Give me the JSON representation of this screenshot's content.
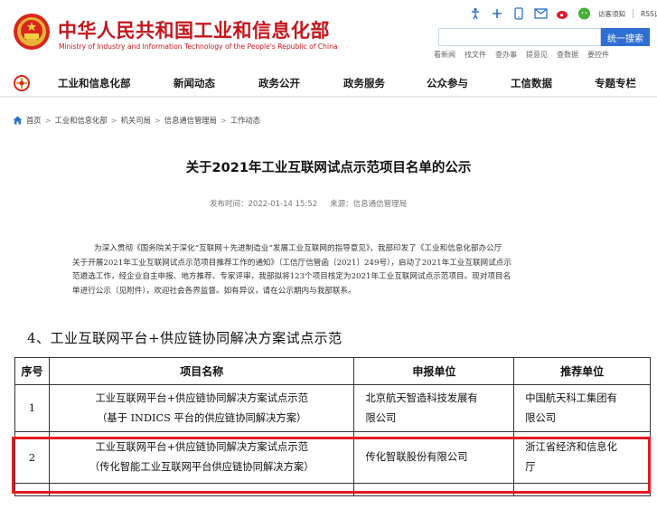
{
  "header": {
    "title_cn": "中华人民共和国工业和信息化部",
    "title_en": "Ministry of Industry and Information Technology of the People's Republic of China",
    "util": {
      "visitor_notice": "访客须知",
      "rss": "RSS订阅"
    },
    "search_button": "统一搜索",
    "tools": [
      "看新闻",
      "找文件",
      "查办事",
      "提意见",
      "查数据",
      "要控件"
    ]
  },
  "nav": {
    "items": [
      "工业和信息化部",
      "新闻动态",
      "政务公开",
      "政务服务",
      "公众参与",
      "工信数据",
      "专题专栏"
    ]
  },
  "breadcrumb": [
    "首页",
    "工业和信息化部",
    "机关司局",
    "信息通信管理局",
    "工作动态"
  ],
  "article": {
    "title": "关于2021年工业互联网试点示范项目名单的公示",
    "published": "发布时间：2022-01-14 15:52",
    "source": "来源：信息通信管理局",
    "paragraph_lines": [
      "为深入贯彻《国务院关于深化“互联网＋先进制造业”发展工业互联网的指导意见》，我部印发了《工业和信息化部办公厅",
      "关于开展2021年工业互联网试点示范项目推荐工作的通知》（工信厅信管函〔2021〕249号），启动了2021年工业互联网试点示",
      "范遴选工作，经企业自主申报、地方推荐、专家评审，我部拟将123个项目核定为2021年工业互联网试点示范项目。现对项目名",
      "单进行公示（见附件），欢迎社会各界监督。如有异议，请在公示期内与我部联系。"
    ],
    "section_heading": "4、工业互联网平台+供应链协同解决方案试点示范",
    "table": {
      "headers": [
        "序号",
        "项目名称",
        "申报单位",
        "推荐单位"
      ],
      "rows": [
        {
          "no": "1",
          "name_line1": "工业互联网平台+供应链协同解决方案试点示范",
          "name_line2": "（基于 INDICS 平台的供应链协同解决方案）",
          "unit_line1": "北京航天智造科技发展有",
          "unit_line2": "限公司",
          "rec_line1": "中国航天科工集团有",
          "rec_line2": "限公司"
        },
        {
          "no": "2",
          "name_line1": "工业互联网平台+供应链协同解决方案试点示范",
          "name_line2": "（传化智能工业互联网平台供应链协同解决方案）",
          "unit_line1": "传化智联股份有限公司",
          "rec_line1": "浙江省经济和信息化",
          "rec_line2": "厅"
        }
      ]
    }
  },
  "colors": {
    "brand_red": "#c4161c",
    "search_blue": "#2f6fd1",
    "highlight_red": "#e31a24"
  }
}
